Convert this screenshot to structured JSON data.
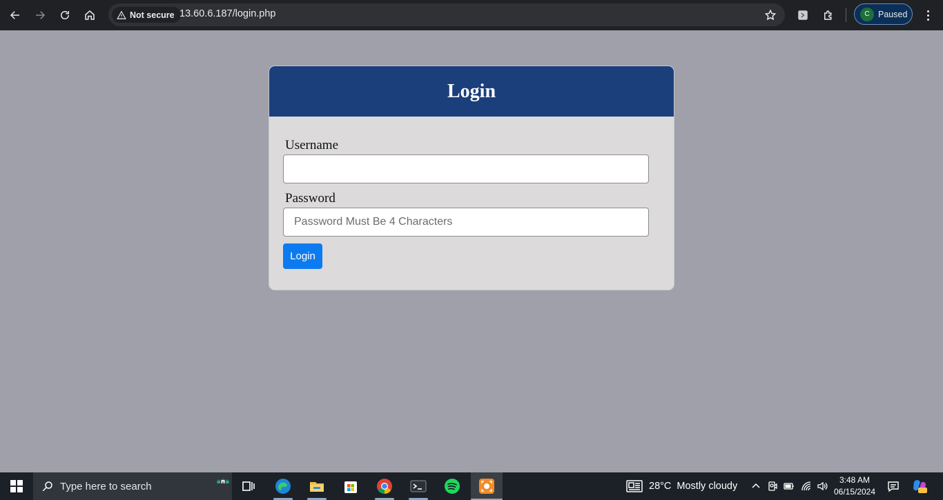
{
  "browser": {
    "security_label": "Not secure",
    "url": "13.60.6.187/login.php",
    "profile_initial": "C",
    "profile_status": "Paused"
  },
  "login": {
    "title": "Login",
    "username_label": "Username",
    "username_value": "",
    "password_label": "Password",
    "password_placeholder": "Password Must Be 4 Characters",
    "submit_label": "Login"
  },
  "taskbar": {
    "search_placeholder": "Type here to search",
    "apps": [
      "task-view",
      "edge",
      "file-explorer",
      "microsoft-store",
      "chrome",
      "terminal",
      "spotify",
      "screen-recorder"
    ],
    "weather_temp": "28°C",
    "weather_desc": "Mostly cloudy",
    "time": "3:48 AM",
    "date": "06/15/2024"
  },
  "colors": {
    "page_bg": "#a0a0ab",
    "card_header": "#1b3f7a",
    "card_body": "#dcdadb",
    "button": "#0d7bf0"
  }
}
